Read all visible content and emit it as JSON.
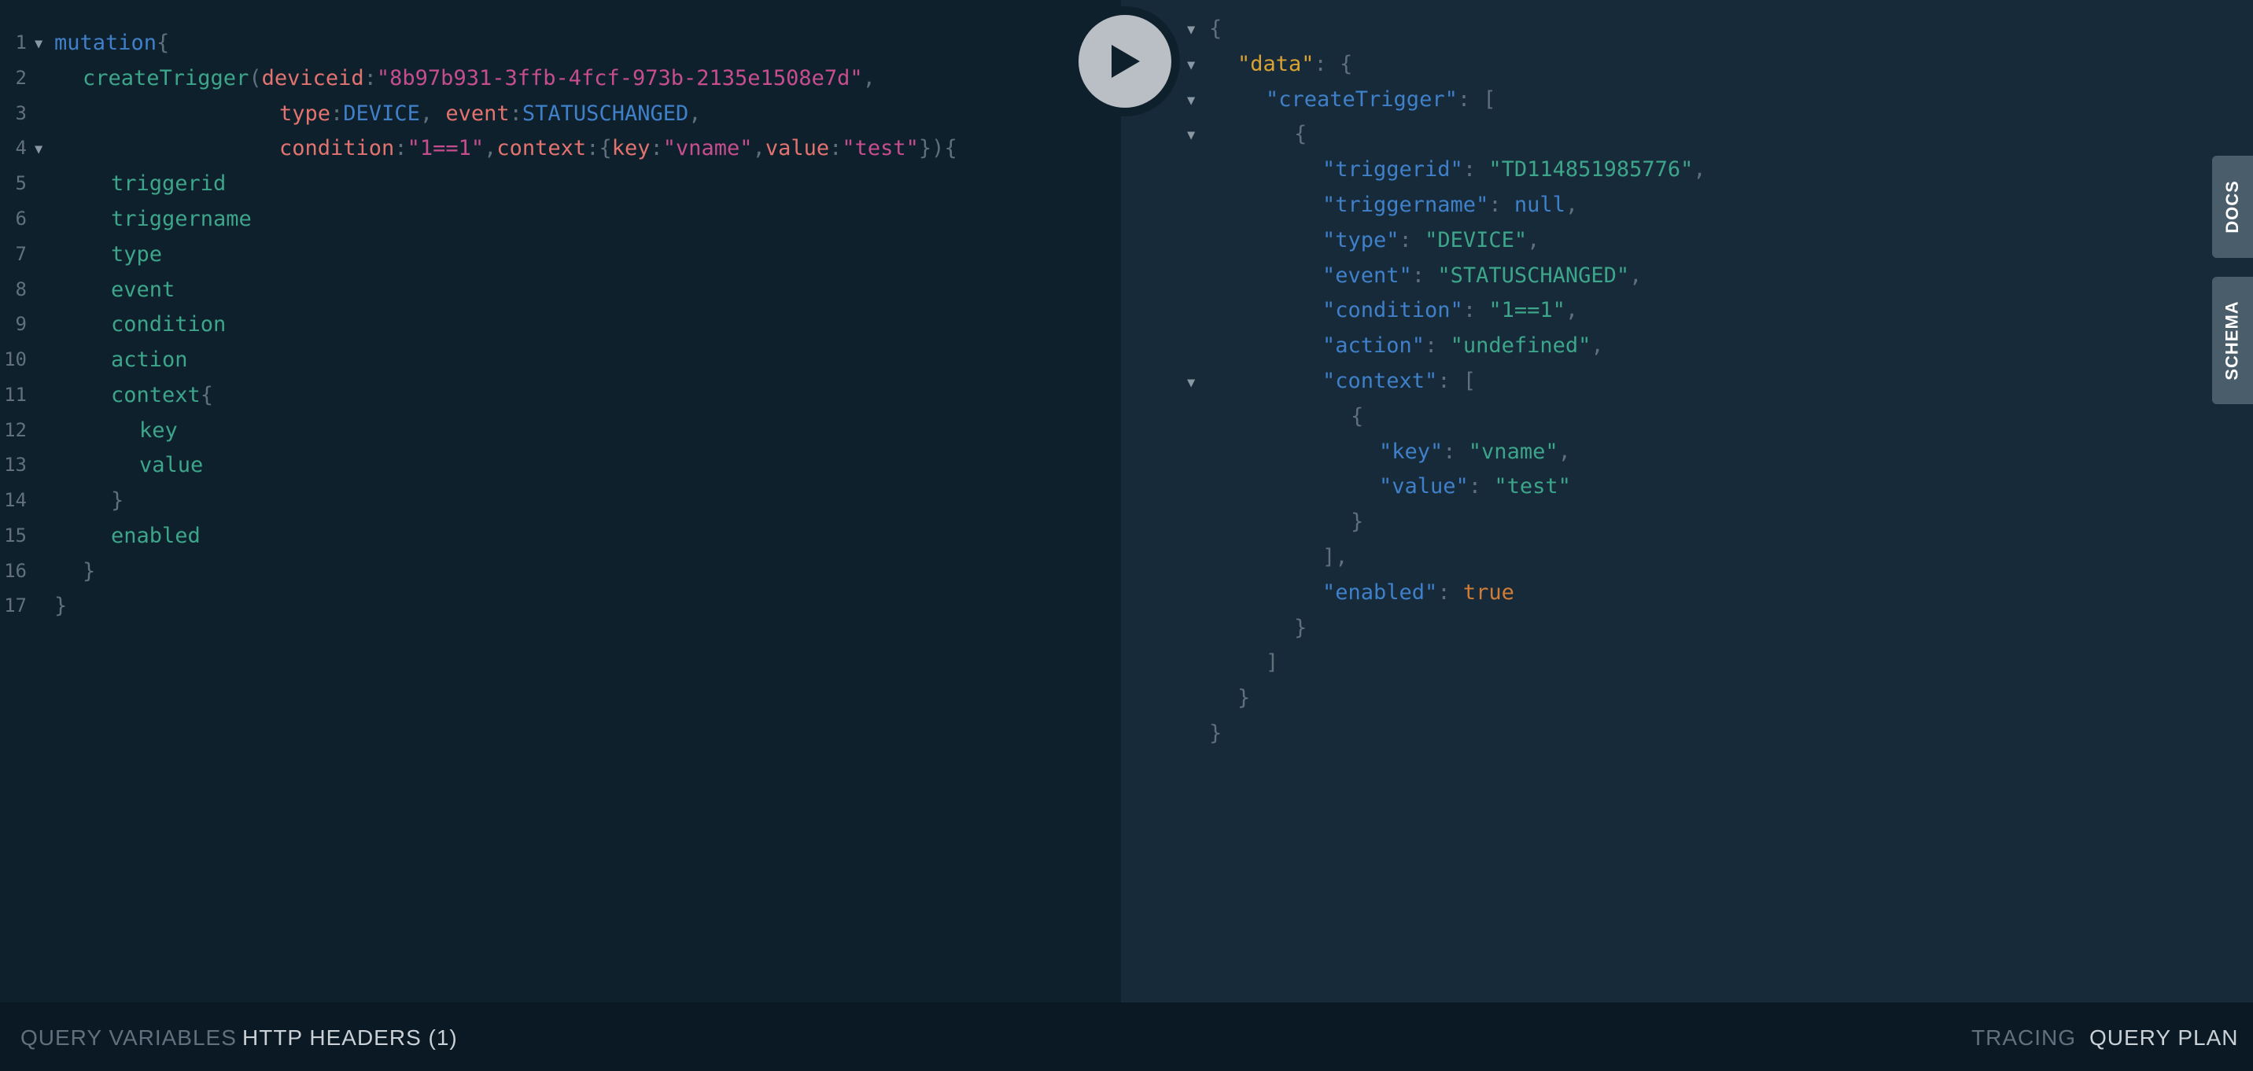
{
  "query_editor": {
    "line_numbers": [
      "1",
      "2",
      "3",
      "4",
      "5",
      "6",
      "7",
      "8",
      "9",
      "10",
      "11",
      "12",
      "13",
      "14",
      "15",
      "16",
      "17"
    ],
    "line1": {
      "keyword": "mutation",
      "brace": "{"
    },
    "line2": {
      "field": "createTrigger",
      "paren_open": "(",
      "arg_name": "deviceid",
      "colon": ":",
      "arg_value": "\"8b97b931-3ffb-4fcf-973b-2135e1508e7d\"",
      "comma": ","
    },
    "line3": {
      "arg1_name": "type",
      "colon1": ":",
      "arg1_value": "DEVICE",
      "sep": ", ",
      "arg2_name": "event",
      "colon2": ":",
      "arg2_value": "STATUSCHANGED",
      "comma": ","
    },
    "line4": {
      "arg1_name": "condition",
      "colon1": ":",
      "arg1_value": "\"1==1\"",
      "comma1": ",",
      "arg2_name": "context",
      "colon2": ":",
      "brace_open": "{",
      "key_name": "key",
      "colon3": ":",
      "key_value": "\"vname\"",
      "comma2": ",",
      "value_name": "value",
      "colon4": ":",
      "value_value": "\"test\"",
      "close": "})",
      "brace": "{"
    },
    "fields": {
      "triggerid": "triggerid",
      "triggername": "triggername",
      "type": "type",
      "event": "event",
      "condition": "condition",
      "action": "action",
      "context": "context",
      "context_brace": "{",
      "key": "key",
      "value": "value",
      "context_close": "}",
      "enabled": "enabled",
      "close_inner": "}",
      "close_outer": "}"
    }
  },
  "result_viewer": {
    "open_brace": "{",
    "data_key": "\"data\"",
    "create_trigger_key": "\"createTrigger\"",
    "array_open": "[",
    "object_open": "{",
    "triggerid": {
      "key": "\"triggerid\"",
      "value": "\"TD114851985776\""
    },
    "triggername": {
      "key": "\"triggername\"",
      "value": "null"
    },
    "type": {
      "key": "\"type\"",
      "value": "\"DEVICE\""
    },
    "event": {
      "key": "\"event\"",
      "value": "\"STATUSCHANGED\""
    },
    "condition": {
      "key": "\"condition\"",
      "value": "\"1==1\""
    },
    "action": {
      "key": "\"action\"",
      "value": "\"undefined\""
    },
    "context": {
      "key": "\"context\""
    },
    "ctx_key": {
      "key": "\"key\"",
      "value": "\"vname\""
    },
    "ctx_value": {
      "key": "\"value\"",
      "value": "\"test\""
    },
    "enabled": {
      "key": "\"enabled\"",
      "value": "true"
    },
    "colon": ": ",
    "comma": ",",
    "close_brace": "}",
    "close_array": "]",
    "close_array_comma": "],"
  },
  "side_tabs": {
    "docs": "DOCS",
    "schema": "SCHEMA"
  },
  "bottom_bar": {
    "query_variables": "QUERY VARIABLES",
    "http_headers": "HTTP HEADERS (1)",
    "tracing": "TRACING",
    "query_plan": "QUERY PLAN"
  },
  "icons": {
    "play": "play-icon",
    "fold": "fold-arrow-icon"
  },
  "colors": {
    "editor_bg": "#0f202d",
    "result_bg": "#172a3a",
    "bottom_bg": "#0b1924",
    "keyword": "#3f80c9",
    "field": "#3da58a",
    "argument": "#e3736f",
    "string_arg": "#c74e8e",
    "json_string": "#3da58a",
    "json_bool": "#d27d36",
    "data_key": "#d9a232"
  }
}
